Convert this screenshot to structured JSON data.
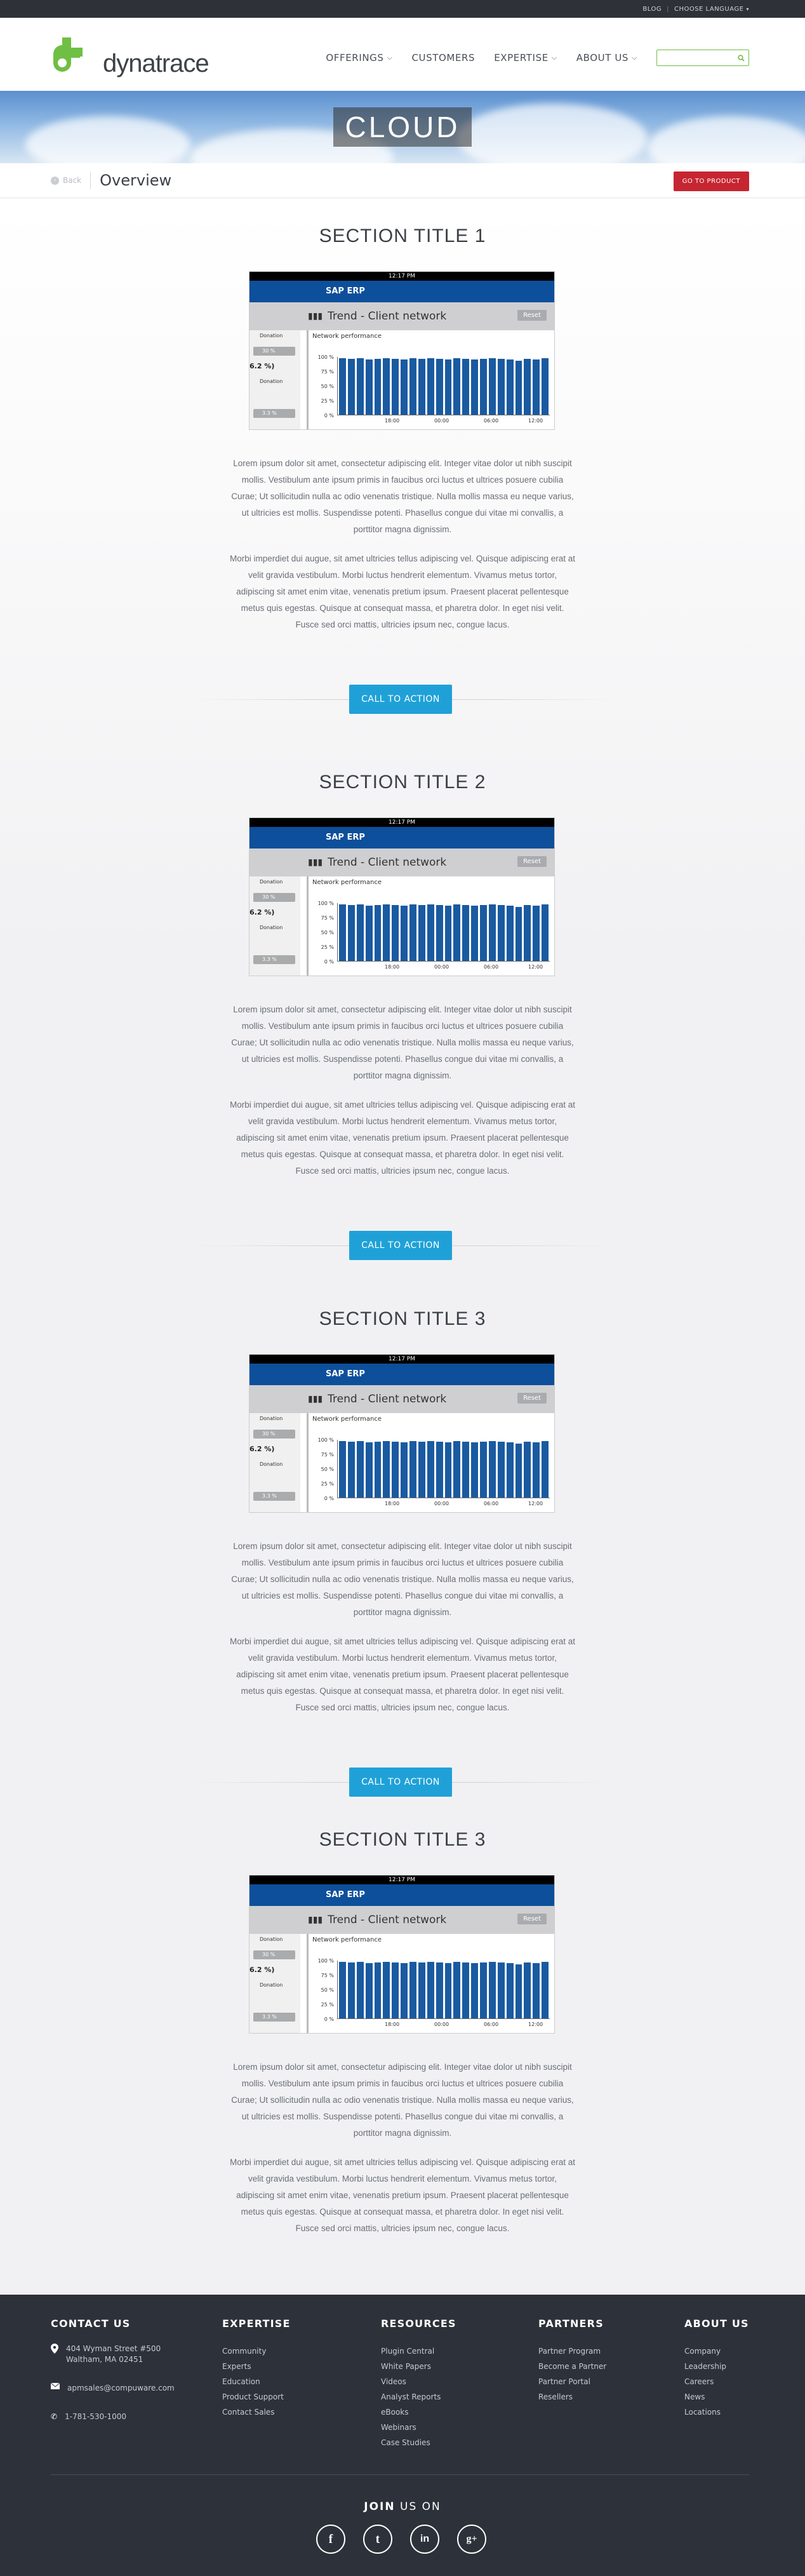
{
  "topbar": {
    "blog": "BLOG",
    "language": "CHOOSE LANGUAGE"
  },
  "logo": {
    "text": "dynatrace"
  },
  "nav": {
    "offerings": "OFFERINGS",
    "customers": "CUSTOMERS",
    "expertise": "EXPERTISE",
    "about": "ABOUT US"
  },
  "hero": {
    "title": "CLOUD"
  },
  "subbar": {
    "back": "Back",
    "title": "Overview",
    "go_product": "GO TO PRODUCT"
  },
  "screenshot": {
    "time": "12:17 PM",
    "app": "SAP ERP",
    "trend": "Trend - Client network",
    "reset": "Reset",
    "panel_title": "Network performance",
    "side_label1": "Donation",
    "side_pill1": "30 %",
    "side_big": "6.2 %)",
    "side_label2": "Donation",
    "side_pill2": "3.3 %",
    "yticks": [
      "100 %",
      "75 %",
      "50 %",
      "25 %",
      "0 %"
    ],
    "xticks": [
      "18:00",
      "00:00",
      "06:00",
      "12:00"
    ],
    "bar_levels": [
      0.98,
      0.97,
      0.98,
      0.96,
      0.97,
      0.98,
      0.97,
      0.96,
      0.98,
      0.97,
      0.98,
      0.97,
      0.96,
      0.98,
      0.97,
      0.96,
      0.97,
      0.98,
      0.97,
      0.96,
      0.93,
      0.97,
      0.96,
      0.98
    ]
  },
  "paragraph1": "Lorem ipsum dolor sit amet, consectetur adipiscing elit. Integer vitae dolor ut nibh suscipit mollis. Vestibulum ante ipsum primis in faucibus orci luctus et ultrices posuere cubilia Curae; Ut sollicitudin nulla ac odio venenatis tristique. Nulla mollis massa eu neque varius, ut ultricies est mollis. Suspendisse potenti. Phasellus congue dui vitae mi convallis, a porttitor magna dignissim.",
  "paragraph2": "Morbi imperdiet dui augue, sit amet ultricies tellus adipiscing vel. Quisque adipiscing erat at velit gravida vestibulum. Morbi luctus hendrerit elementum. Vivamus metus tortor, adipiscing sit amet enim vitae, venenatis pretium ipsum. Praesent placerat pellentesque metus quis egestas. Quisque at consequat massa, et pharetra dolor. In eget nisi velit. Fusce sed orci mattis, ultricies ipsum nec, congue lacus.",
  "sections": [
    {
      "title": "SECTION TITLE 1",
      "cta": "CALL TO ACTION"
    },
    {
      "title": "SECTION TITLE 2",
      "cta": "CALL TO ACTION"
    },
    {
      "title": "SECTION TITLE 3",
      "cta": "CALL TO ACTION"
    },
    {
      "title": "SECTION TITLE 3"
    }
  ],
  "footer": {
    "contact": {
      "title": "CONTACT US",
      "address1": "404 Wyman Street #500",
      "address2": "Waltham, MA 02451",
      "email": "apmsales@compuware.com",
      "phone": "1-781-530-1000"
    },
    "expertise": {
      "title": "EXPERTISE",
      "links": [
        "Community",
        "Experts",
        "Education",
        "Product Support",
        "Contact Sales"
      ]
    },
    "resources": {
      "title": "RESOURCES",
      "links": [
        "Plugin Central",
        "White Papers",
        "Videos",
        "Analyst Reports",
        "eBooks",
        "Webinars",
        "Case Studies"
      ]
    },
    "partners": {
      "title": "PARTNERS",
      "links": [
        "Partner Program",
        "Become a Partner",
        "Partner Portal",
        "Resellers"
      ]
    },
    "about": {
      "title": "ABOUT US",
      "links": [
        "Company",
        "Leadership",
        "Careers",
        "News",
        "Locations"
      ]
    },
    "join_bold": "JOIN",
    "join_rest": " US ON",
    "social": [
      "f",
      "t",
      "in",
      "g+"
    ]
  },
  "colors": {
    "brand_green": "#6fbf44",
    "cta_blue": "#1fa1d8",
    "go_red": "#c62531",
    "footer_bg": "#2d3139"
  }
}
